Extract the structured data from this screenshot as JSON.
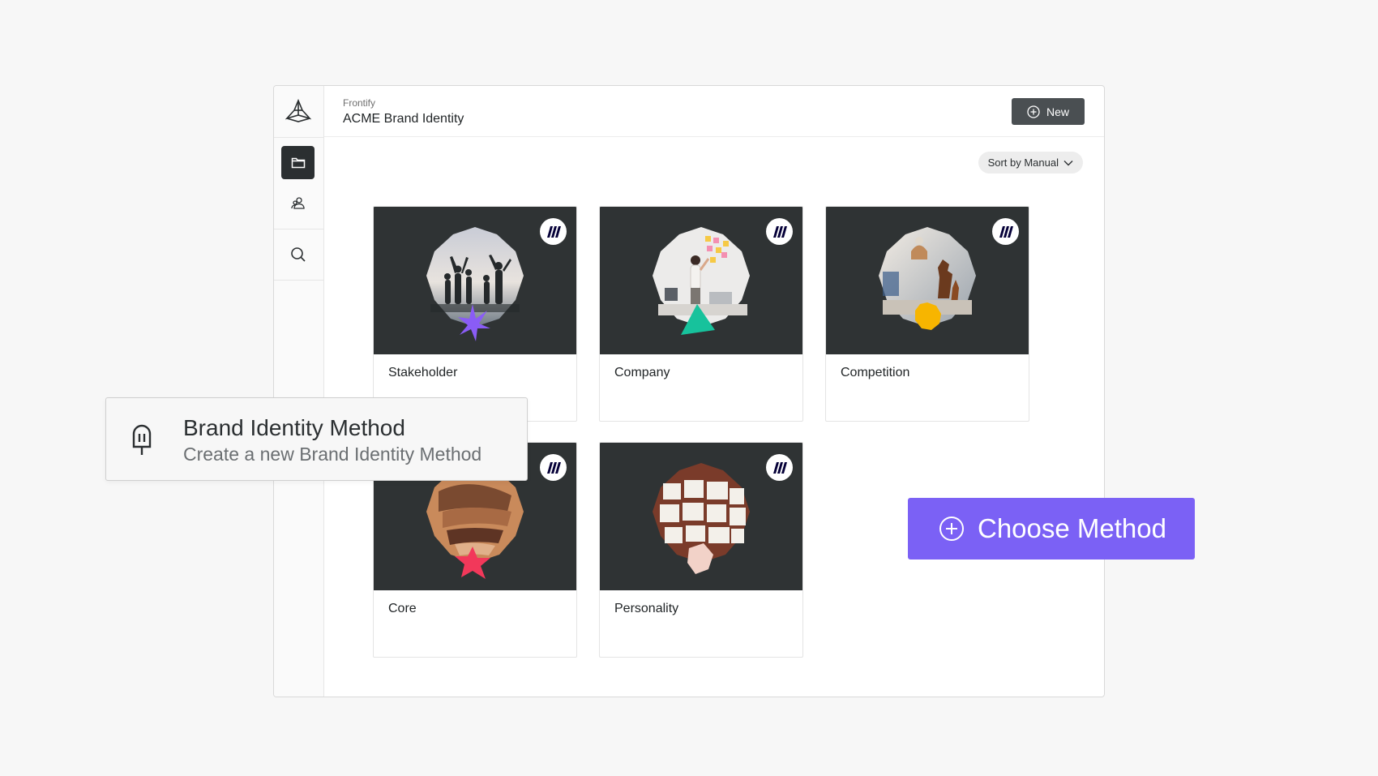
{
  "header": {
    "org": "Frontify",
    "title": "ACME Brand Identity",
    "new_label": "New"
  },
  "toolbar": {
    "sort_label": "Sort by Manual"
  },
  "cards": [
    {
      "label": "Stakeholder"
    },
    {
      "label": "Company"
    },
    {
      "label": "Competition"
    },
    {
      "label": "Core"
    },
    {
      "label": "Personality"
    }
  ],
  "tooltip": {
    "title": "Brand Identity Method",
    "subtitle": "Create a new Brand Identity Method"
  },
  "cta": {
    "label": "Choose Method"
  },
  "colors": {
    "accent": "#7b61f5",
    "dark": "#2f3334",
    "card_bg": "#ffffff"
  },
  "icons": [
    "frontify-logo-icon",
    "folder-icon",
    "users-icon",
    "search-icon",
    "plus-circle-icon",
    "chevron-down-icon",
    "miro-logo-icon",
    "popsicle-icon"
  ]
}
